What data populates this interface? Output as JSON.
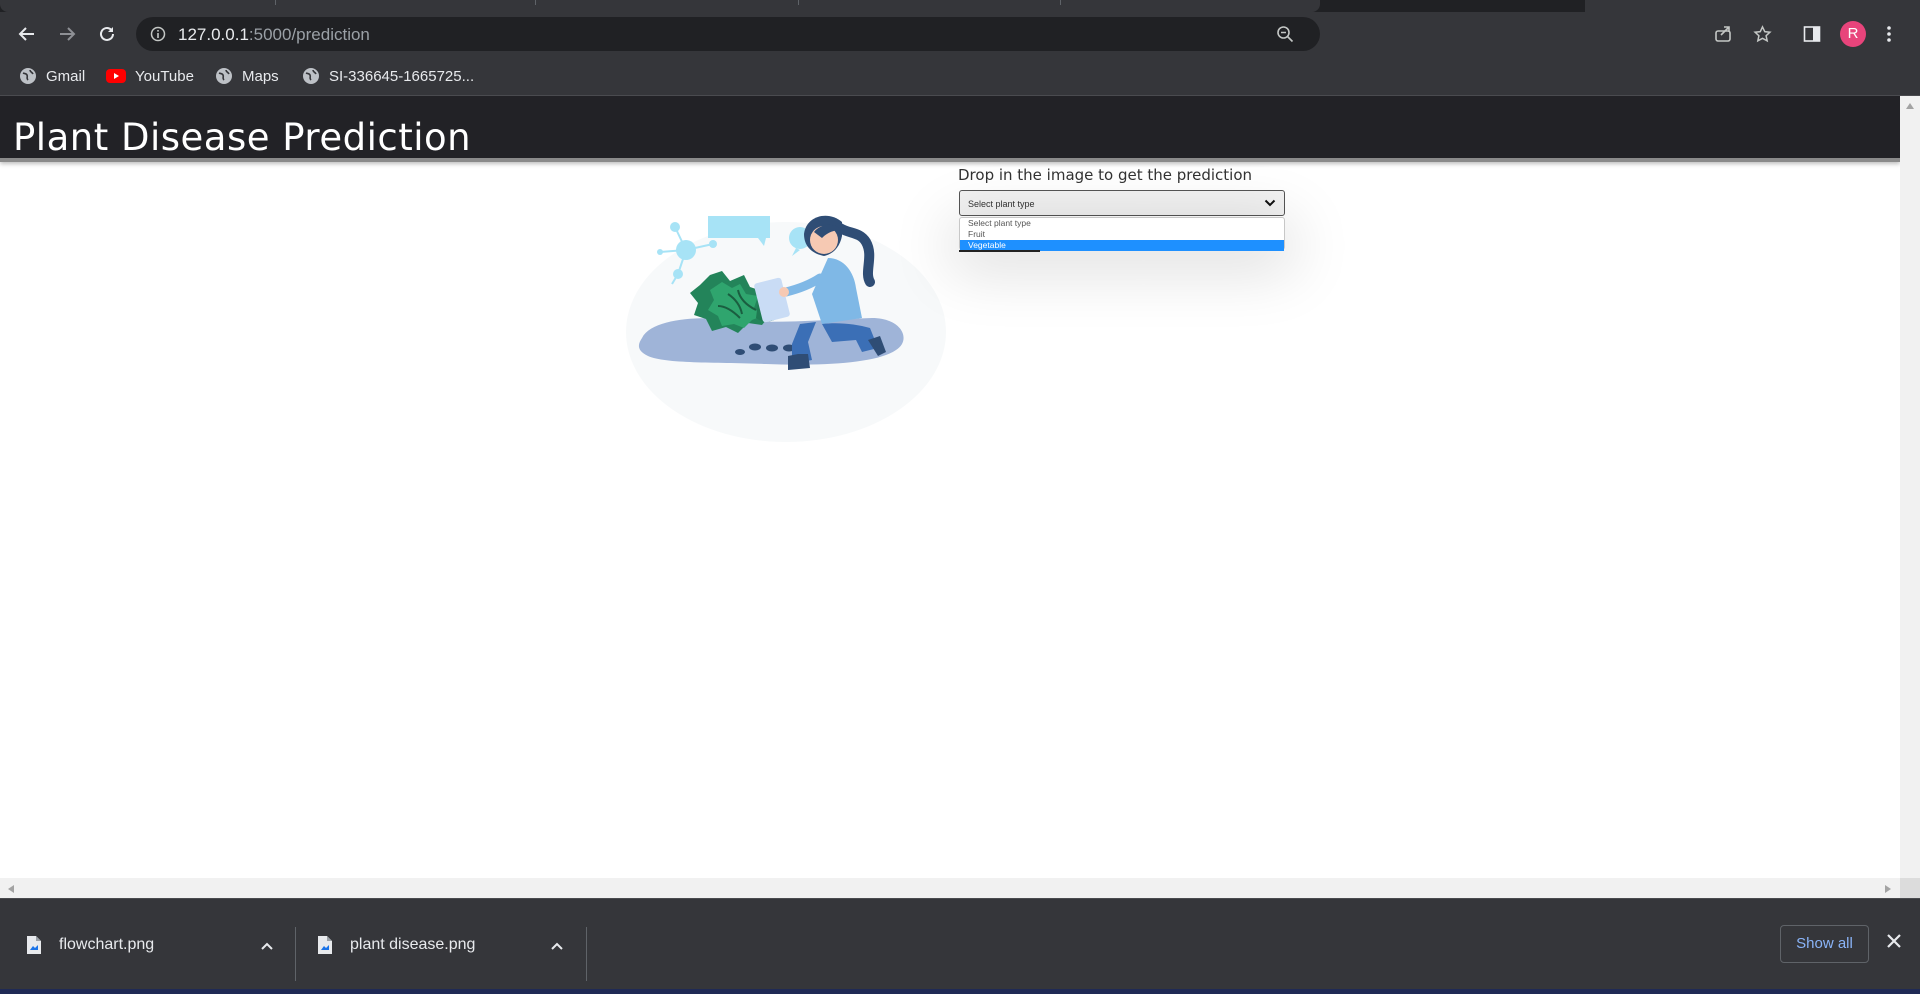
{
  "browser": {
    "url_host": "127.0.0.1",
    "url_path": ":5000/prediction",
    "profile_initial": "R",
    "profile_color": "#e8447b"
  },
  "bookmarks": [
    {
      "label": "Gmail",
      "icon": "globe-icon"
    },
    {
      "label": "YouTube",
      "icon": "youtube-icon"
    },
    {
      "label": "Maps",
      "icon": "globe-icon"
    },
    {
      "label": "SI-336645-1665725...",
      "icon": "globe-icon"
    }
  ],
  "page": {
    "title": "Plant Disease Prediction",
    "drop_label": "Drop in the image to get the prediction",
    "select_value": "Select plant type",
    "select_options": [
      "Select plant type",
      "Fruit",
      "Vegetable"
    ],
    "highlighted_option": "Vegetable",
    "illustration": "woman-inspecting-plants-with-tablet",
    "header_color": "#222226",
    "highlight_color": "#1e90ff"
  },
  "downloads": [
    {
      "filename": "flowchart.png",
      "icon": "image-file-icon"
    },
    {
      "filename": "plant disease.png",
      "icon": "image-file-icon"
    }
  ],
  "downloads_show_all": "Show all"
}
